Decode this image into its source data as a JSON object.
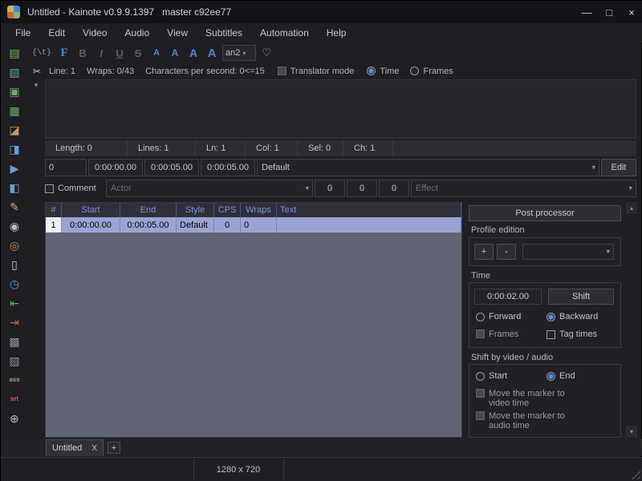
{
  "window": {
    "title": "Untitled - Kainote v0.9.9.1397   master c92ee77",
    "minimize": "—",
    "maximize": "□",
    "close": "×"
  },
  "menu": {
    "items": [
      "File",
      "Edit",
      "Video",
      "Audio",
      "View",
      "Subtitles",
      "Automation",
      "Help"
    ]
  },
  "toolbar": {
    "tag": "{\\t}",
    "font": "F",
    "bold": "B",
    "italic": "I",
    "underline": "U",
    "strike": "S",
    "colors": [
      "A",
      "A",
      "A",
      "A"
    ],
    "alignment": "an2"
  },
  "glyphs": {
    "chevron": "▾",
    "scroll_up": "▴",
    "scroll_down": "▾",
    "scissors": "✂",
    "heart": "♡"
  },
  "info": {
    "line": "Line: 1",
    "wraps": "Wraps: 0/43",
    "cps": "Characters per second: 0<=15",
    "translator": "Translator mode",
    "time": "Time",
    "frames": "Frames"
  },
  "editor": {
    "text": ""
  },
  "stats": [
    "Length: 0",
    "Lines: 1",
    "Ln: 1",
    "Col: 1",
    "Sel: 0",
    "Ch: 1"
  ],
  "line": {
    "layer": "0",
    "start": "0:00:00.00",
    "end": "0:00:05.00",
    "duration": "0:00:05.00",
    "style": "Default",
    "edit": "Edit"
  },
  "meta": {
    "comment": "Comment",
    "actor": "Actor",
    "m1": "0",
    "m2": "0",
    "m3": "0",
    "effect": "Effect"
  },
  "grid": {
    "columns": [
      "#",
      "Start",
      "End",
      "Style",
      "CPS",
      "Wraps",
      "Text"
    ],
    "rows": [
      [
        "1",
        "0:00:00.00",
        "0:00:05.00",
        "Default",
        "0",
        "0",
        ""
      ]
    ]
  },
  "panel": {
    "post_processor": "Post processor",
    "profile_edition": "Profile edition",
    "plus": "+",
    "minus": "-",
    "time_label": "Time",
    "shift_time": "0:00:02.00",
    "shift": "Shift",
    "forward": "Forward",
    "backward": "Backward",
    "frames": "Frames",
    "tag_times": "Tag times",
    "shift_group": "Shift by video / audio",
    "start": "Start",
    "end": "End",
    "marker_video": "Move the marker to video time",
    "marker_audio": "Move the marker to audio time"
  },
  "tabs": {
    "active": "Untitled",
    "close": "X",
    "add": "+"
  },
  "status": {
    "resolution": "1280 x 720"
  },
  "left_toolbar": {
    "icons": [
      {
        "name": "new-subtitles",
        "glyph": "▤"
      },
      {
        "name": "open-subtitles",
        "glyph": "▧"
      },
      {
        "name": "save",
        "glyph": "▣"
      },
      {
        "name": "save-all",
        "glyph": "▦"
      },
      {
        "name": "save-as",
        "glyph": "◪"
      },
      {
        "name": "save-translation",
        "glyph": "◨"
      },
      {
        "name": "open-video",
        "glyph": "▶"
      },
      {
        "name": "subtitles-from-video",
        "glyph": "◧"
      },
      {
        "name": "style-manager",
        "glyph": "✎"
      },
      {
        "name": "find-replace",
        "glyph": "◉"
      },
      {
        "name": "select-lines",
        "glyph": "◎"
      },
      {
        "name": "paste-options",
        "glyph": "▯"
      },
      {
        "name": "history",
        "glyph": "◷"
      },
      {
        "name": "previous-line",
        "glyph": "⇤"
      },
      {
        "name": "next-line",
        "glyph": "⇥"
      },
      {
        "name": "ass-tags",
        "glyph": "▩"
      },
      {
        "name": "auto-split",
        "glyph": "▨"
      },
      {
        "name": "ass-properties",
        "glyph": "ass"
      },
      {
        "name": "srt-conversion",
        "glyph": "srt"
      },
      {
        "name": "zoom",
        "glyph": "⊕"
      }
    ]
  }
}
